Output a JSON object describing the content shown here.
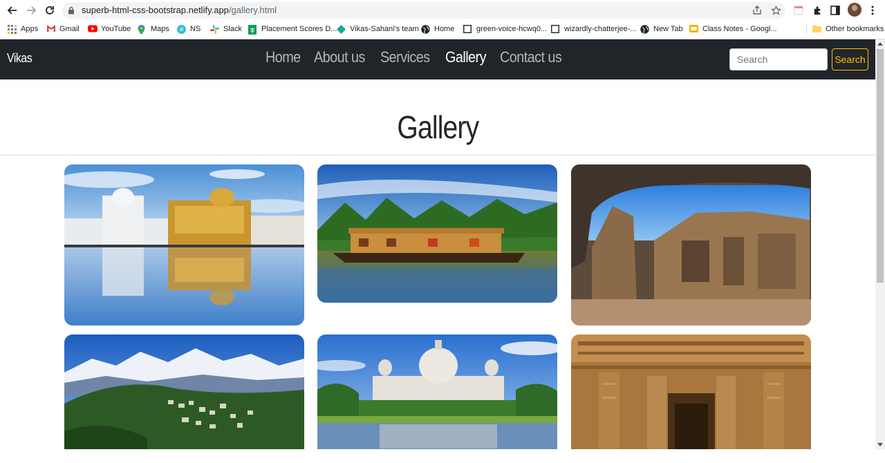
{
  "browser": {
    "url_domain": "superb-html-css-bootstrap.netlify.app",
    "url_path": "/gallery.html",
    "bookmarks": [
      {
        "label": "Apps",
        "icon": "apps-grid-icon"
      },
      {
        "label": "Gmail",
        "icon": "gmail-icon"
      },
      {
        "label": "YouTube",
        "icon": "youtube-icon"
      },
      {
        "label": "Maps",
        "icon": "maps-icon"
      },
      {
        "label": "NS",
        "icon": "ns-icon"
      },
      {
        "label": "Slack",
        "icon": "slack-icon"
      },
      {
        "label": "Placement Scores D...",
        "icon": "sheets-icon"
      },
      {
        "label": "Vikas-Sahani's team",
        "icon": "diamond-icon"
      },
      {
        "label": "Home",
        "icon": "globe-icon"
      },
      {
        "label": "green-voice-hcwq0...",
        "icon": "page-icon"
      },
      {
        "label": "wizardly-chatterjee-...",
        "icon": "page-icon"
      },
      {
        "label": "New Tab",
        "icon": "globe-icon"
      },
      {
        "label": "Class Notes - Googl...",
        "icon": "slides-icon"
      }
    ],
    "other_bookmarks": "Other bookmarks"
  },
  "site": {
    "brand": "Vikas",
    "nav": [
      "Home",
      "About us",
      "Services",
      "Gallery",
      "Contact us"
    ],
    "active_nav": "Gallery",
    "search_placeholder": "Search",
    "search_button": "Search",
    "heading": "Gallery"
  },
  "colors": {
    "navbar": "#212529",
    "nav_link": "#b4b6b8",
    "nav_active": "#ffffff",
    "search_accent": "#ffc107"
  },
  "gallery": [
    {
      "subject": "golden-temple-image"
    },
    {
      "subject": "kerala-houseboat-image"
    },
    {
      "subject": "ellora-caves-image"
    },
    {
      "subject": "darjeeling-hills-image"
    },
    {
      "subject": "victoria-memorial-image"
    },
    {
      "subject": "stepwell-carving-image"
    }
  ]
}
